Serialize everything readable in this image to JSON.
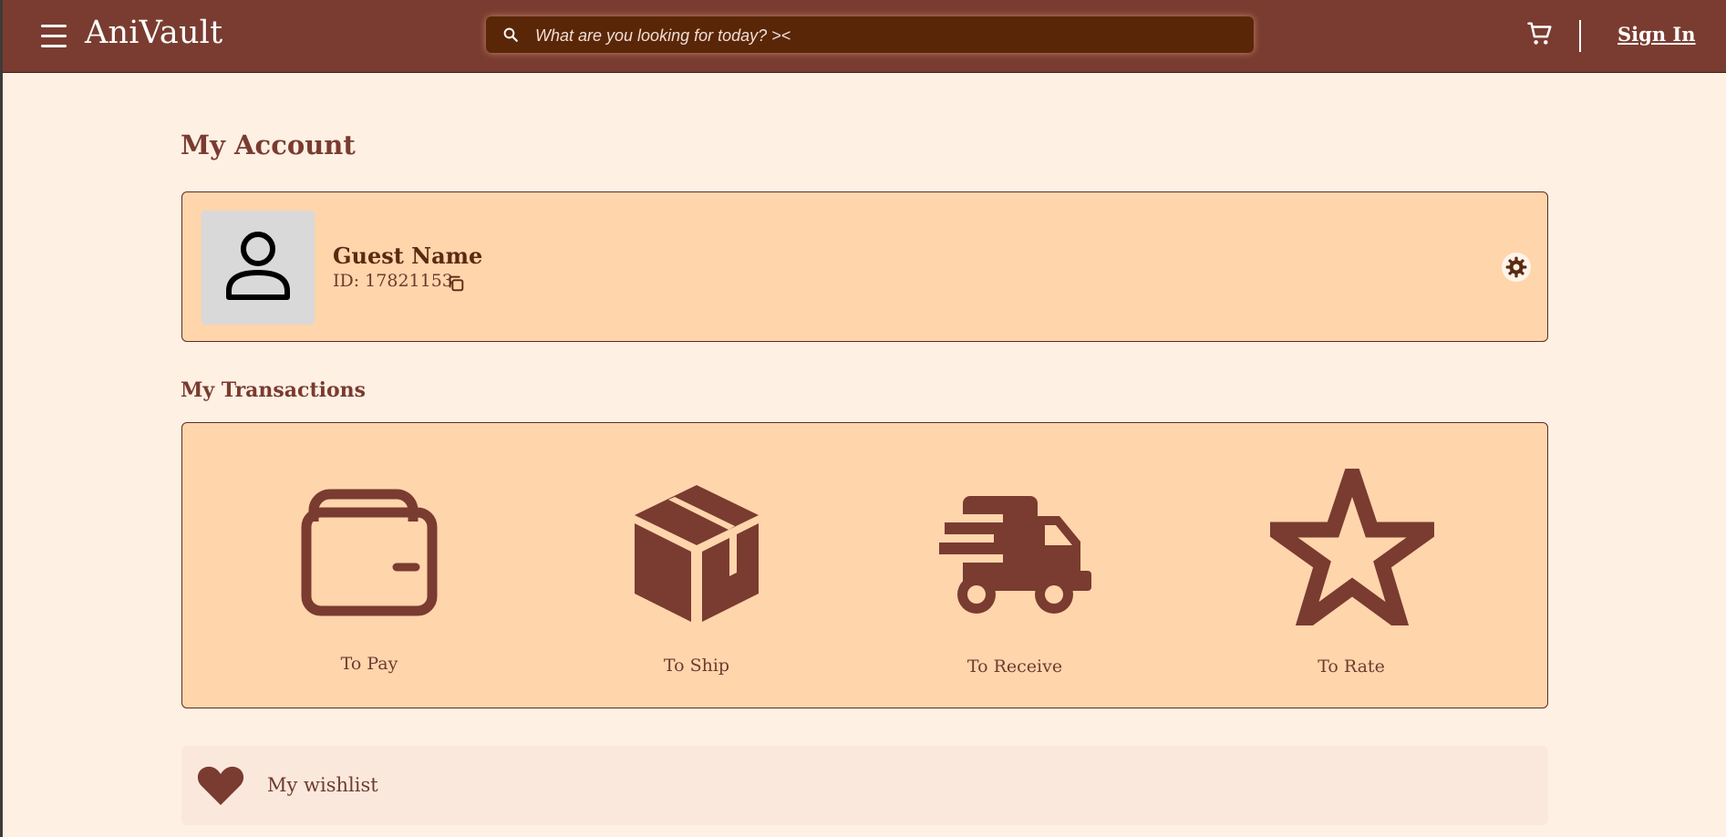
{
  "header": {
    "brand": "AniVault",
    "search_placeholder": "What are you looking for today? ><",
    "signin_label": "Sign In"
  },
  "page": {
    "title": "My Account"
  },
  "profile": {
    "name": "Guest Name",
    "id_text": "ID: 17821153"
  },
  "transactions": {
    "title": "My Transactions",
    "items": [
      {
        "label": "To Pay",
        "icon": "wallet-icon"
      },
      {
        "label": "To Ship",
        "icon": "box-icon"
      },
      {
        "label": "To Receive",
        "icon": "truck-icon"
      },
      {
        "label": "To Rate",
        "icon": "star-icon"
      }
    ]
  },
  "wishlist": {
    "label": "My wishlist",
    "icon": "heart-icon"
  },
  "colors": {
    "header_bg": "#7a3c30",
    "page_bg": "#fff0e4",
    "card_bg": "#ffd5ac",
    "accent": "#7a3b30",
    "search_bg": "#5a2608"
  }
}
